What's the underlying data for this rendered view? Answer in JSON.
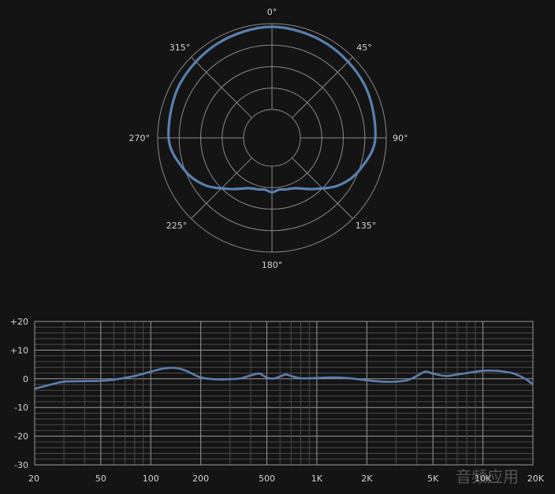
{
  "chart_data": [
    {
      "type": "polar",
      "angle_labels": [
        "0°",
        "45°",
        "90°",
        "135°",
        "180°",
        "225°",
        "270°",
        "315°"
      ],
      "rings": 5,
      "pattern": "cardioid",
      "series_color": "#5b7fae",
      "polar_points": [
        {
          "angle": 0,
          "r": 1.0
        },
        {
          "angle": 30,
          "r": 0.98
        },
        {
          "angle": 60,
          "r": 0.96
        },
        {
          "angle": 90,
          "r": 0.93
        },
        {
          "angle": 110,
          "r": 0.84
        },
        {
          "angle": 125,
          "r": 0.74
        },
        {
          "angle": 140,
          "r": 0.6
        },
        {
          "angle": 155,
          "r": 0.5
        },
        {
          "angle": 165,
          "r": 0.48
        },
        {
          "angle": 172,
          "r": 0.47
        },
        {
          "angle": 180,
          "r": 0.49
        },
        {
          "angle": 188,
          "r": 0.47
        },
        {
          "angle": 195,
          "r": 0.48
        },
        {
          "angle": 205,
          "r": 0.5
        },
        {
          "angle": 220,
          "r": 0.6
        },
        {
          "angle": 235,
          "r": 0.74
        },
        {
          "angle": 250,
          "r": 0.84
        },
        {
          "angle": 270,
          "r": 0.93
        },
        {
          "angle": 300,
          "r": 0.96
        },
        {
          "angle": 330,
          "r": 0.98
        }
      ]
    },
    {
      "type": "line",
      "x_scale": "log",
      "x_ticks": [
        "20",
        "50",
        "100",
        "200",
        "500",
        "1K",
        "2K",
        "5K",
        "10K",
        "20K"
      ],
      "y_ticks": [
        "+20",
        "+10",
        "0",
        "-10",
        "-20",
        "-30"
      ],
      "ylim": [
        -30,
        20
      ],
      "xlim": [
        20,
        20000
      ],
      "grid": true,
      "series_color": "#5b7fae",
      "x": [
        20,
        25,
        30,
        40,
        50,
        60,
        80,
        100,
        120,
        140,
        160,
        200,
        250,
        300,
        350,
        400,
        450,
        500,
        550,
        600,
        650,
        700,
        800,
        1000,
        1200,
        1500,
        2000,
        2500,
        3000,
        3500,
        4000,
        4500,
        5000,
        6000,
        7000,
        8000,
        10000,
        12000,
        15000,
        18000,
        20000
      ],
      "y": [
        -3.5,
        -2.0,
        -1.0,
        -0.8,
        -0.7,
        -0.3,
        1.0,
        2.5,
        3.6,
        3.8,
        3.0,
        0.5,
        -0.2,
        -0.1,
        0.2,
        1.2,
        1.8,
        0.4,
        0.1,
        0.8,
        1.5,
        1.0,
        0.2,
        0.3,
        0.5,
        0.3,
        -0.5,
        -1.0,
        -1.0,
        -0.5,
        1.0,
        2.5,
        1.8,
        1.0,
        1.5,
        2.0,
        2.8,
        2.8,
        2.0,
        0.0,
        -2.0
      ]
    }
  ],
  "watermark": "音频应用"
}
